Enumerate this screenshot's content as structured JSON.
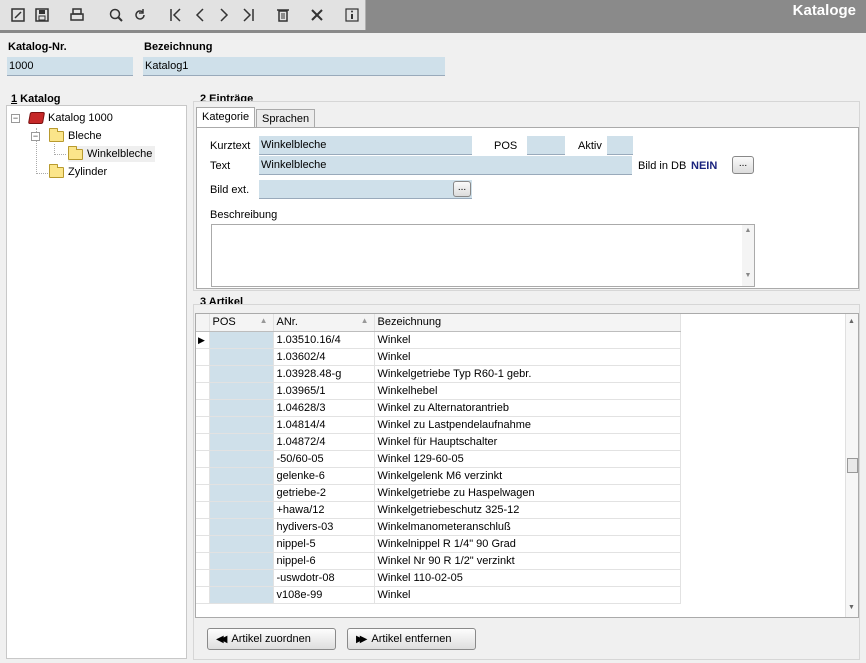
{
  "app_title": "Kataloge",
  "toolbar": {
    "icons": [
      "edit-icon",
      "save-icon",
      "print-icon",
      "search-icon",
      "refresh-icon",
      "first-record-icon",
      "previous-record-icon",
      "next-record-icon",
      "last-record-icon",
      "delete-icon",
      "close-icon",
      "info-icon"
    ]
  },
  "header": {
    "katalog_nr_label": "Katalog-Nr.",
    "katalog_nr_value": "1000",
    "bezeichnung_label": "Bezeichnung",
    "bezeichnung_value": "Katalog1"
  },
  "katalog_panel": {
    "num": "1",
    "title": " Katalog",
    "tree": {
      "root": "Katalog 1000",
      "child1": "Bleche",
      "child1_sub": "Winkelbleche",
      "child2": "Zylinder"
    }
  },
  "eintraege_panel": {
    "num": "2",
    "title": " Einträge",
    "tabs": [
      "Kategorie",
      "Sprachen"
    ],
    "kurztext_label": "Kurztext",
    "kurztext_value": "Winkelbleche",
    "pos_label": "POS",
    "pos_value": "",
    "aktiv_label": "Aktiv",
    "aktiv_value": "",
    "text_label": "Text",
    "text_value": "Winkelbleche",
    "bild_in_db_label": "Bild in DB",
    "bild_in_db_value": "NEIN",
    "bild_ext_label": "Bild ext.",
    "bild_ext_value": "",
    "beschreibung_label": "Beschreibung",
    "beschreibung_value": "",
    "ellipsis": "..."
  },
  "artikel_panel": {
    "num": "3",
    "title": " Artikel",
    "columns": [
      "POS",
      "ANr.",
      "Bezeichnung"
    ],
    "rows": [
      {
        "pos": "",
        "anr": "1.03510.16/4",
        "bez": "Winkel"
      },
      {
        "pos": "",
        "anr": "1.03602/4",
        "bez": "Winkel"
      },
      {
        "pos": "",
        "anr": "1.03928.48-g",
        "bez": "Winkelgetriebe Typ R60-1 gebr."
      },
      {
        "pos": "",
        "anr": "1.03965/1",
        "bez": "Winkelhebel"
      },
      {
        "pos": "",
        "anr": "1.04628/3",
        "bez": "Winkel zu Alternatorantrieb"
      },
      {
        "pos": "",
        "anr": "1.04814/4",
        "bez": "Winkel zu Lastpendelaufnahme"
      },
      {
        "pos": "",
        "anr": "1.04872/4",
        "bez": "Winkel für Hauptschalter"
      },
      {
        "pos": "",
        "anr": "-50/60-05",
        "bez": "Winkel 129-60-05"
      },
      {
        "pos": "",
        "anr": "gelenke-6",
        "bez": "Winkelgelenk M6 verzinkt"
      },
      {
        "pos": "",
        "anr": "getriebe-2",
        "bez": "Winkelgetriebe zu Haspelwagen"
      },
      {
        "pos": "",
        "anr": "+hawa/12",
        "bez": "Winkelgetriebeschutz 325-12"
      },
      {
        "pos": "",
        "anr": "hydivers-03",
        "bez": "Winkelmanometeranschluß"
      },
      {
        "pos": "",
        "anr": "nippel-5",
        "bez": "Winkelnippel R 1/4\" 90 Grad"
      },
      {
        "pos": "",
        "anr": "nippel-6",
        "bez": "Winkel Nr 90 R 1/2\" verzinkt"
      },
      {
        "pos": "",
        "anr": "-uswdotr-08",
        "bez": "Winkel 110-02-05"
      },
      {
        "pos": "",
        "anr": "v108e-99",
        "bez": "Winkel"
      }
    ],
    "btn_zuordnen": "Artikel zuordnen",
    "btn_entfernen": "Artikel entfernen"
  },
  "colors": {
    "field_bg": "#cfe0ea",
    "titlebar": "#8a8a8a",
    "nein_text": "#1a237e"
  }
}
